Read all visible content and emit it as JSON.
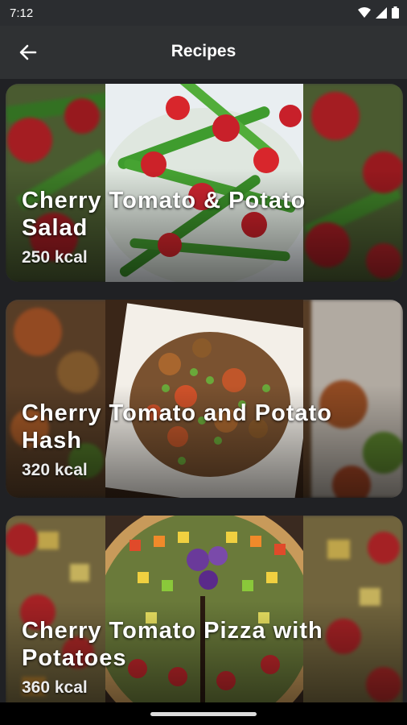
{
  "status_bar": {
    "time": "7:12",
    "icons": [
      "wifi-icon",
      "signal-icon",
      "battery-icon"
    ]
  },
  "app_bar": {
    "title": "Recipes",
    "back_icon": "arrow-back-icon"
  },
  "recipes": [
    {
      "title": "Cherry Tomato & Potato Salad",
      "calories": "250 kcal",
      "image": "green-beans-tomatoes-salad-photo"
    },
    {
      "title": "Cherry Tomato and Potato Hash",
      "calories": "320 kcal",
      "image": "potato-hash-plate-photo"
    },
    {
      "title": "Cherry Tomato Pizza with Potatoes",
      "calories": "360 kcal",
      "image": "rainbow-veggie-pizza-photo"
    }
  ],
  "colors": {
    "background": "#202124",
    "app_bar": "#2f3133",
    "status_bar": "#2b2d30",
    "text": "#ffffff"
  }
}
